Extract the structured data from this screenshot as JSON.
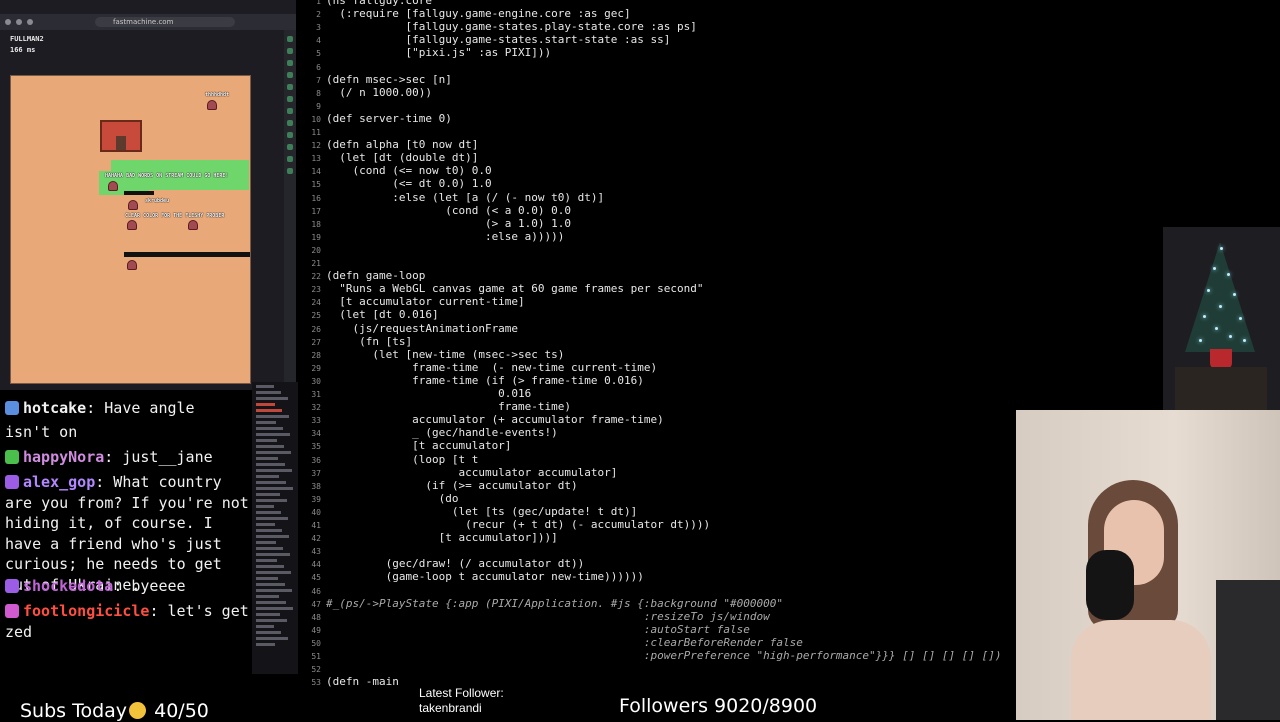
{
  "browser": {
    "url": "fastmachine.com",
    "page_info": [
      "FULLMAN2",
      "166 ms"
    ],
    "game_labels": {
      "npc_top": "thhhdhdt",
      "banner1": "HAHAHA BAD WORDS ON STREAM COULD GO HERE!",
      "banner2": "CLEAR COLOR FOR THE FLESHY PROBER",
      "small": "skrubdeu"
    }
  },
  "editor": {
    "lines": [
      {
        "n": "1",
        "t": "(ns fallguy.core"
      },
      {
        "n": "2",
        "t": "  (:require [fallguy.game-engine.core :as gec]"
      },
      {
        "n": "3",
        "t": "            [fallguy.game-states.play-state.core :as ps]"
      },
      {
        "n": "4",
        "t": "            [fallguy.game-states.start-state :as ss]"
      },
      {
        "n": "5",
        "t": "            [\"pixi.js\" :as PIXI]))"
      },
      {
        "n": "6",
        "t": ""
      },
      {
        "n": "7",
        "t": "(defn msec->sec [n]"
      },
      {
        "n": "8",
        "t": "  (/ n 1000.00))"
      },
      {
        "n": "9",
        "t": ""
      },
      {
        "n": "10",
        "t": "(def server-time 0)"
      },
      {
        "n": "11",
        "t": ""
      },
      {
        "n": "12",
        "t": "(defn alpha [t0 now dt]"
      },
      {
        "n": "13",
        "t": "  (let [dt (double dt)]"
      },
      {
        "n": "14",
        "t": "    (cond (<= now t0) 0.0"
      },
      {
        "n": "15",
        "t": "          (<= dt 0.0) 1.0"
      },
      {
        "n": "16",
        "t": "          :else (let [a (/ (- now t0) dt)]"
      },
      {
        "n": "17",
        "t": "                  (cond (< a 0.0) 0.0"
      },
      {
        "n": "18",
        "t": "                        (> a 1.0) 1.0"
      },
      {
        "n": "19",
        "t": "                        :else a)))))"
      },
      {
        "n": "20",
        "t": ""
      },
      {
        "n": "21",
        "t": ""
      },
      {
        "n": "22",
        "t": "(defn game-loop"
      },
      {
        "n": "23",
        "t": "  \"Runs a WebGL canvas game at 60 game frames per second\""
      },
      {
        "n": "24",
        "t": "  [t accumulator current-time]"
      },
      {
        "n": "25",
        "t": "  (let [dt 0.016]"
      },
      {
        "n": "26",
        "t": "    (js/requestAnimationFrame"
      },
      {
        "n": "27",
        "t": "     (fn [ts]"
      },
      {
        "n": "28",
        "t": "       (let [new-time (msec->sec ts)"
      },
      {
        "n": "29",
        "t": "             frame-time  (- new-time current-time)"
      },
      {
        "n": "30",
        "t": "             frame-time (if (> frame-time 0.016)"
      },
      {
        "n": "31",
        "t": "                          0.016"
      },
      {
        "n": "32",
        "t": "                          frame-time)"
      },
      {
        "n": "33",
        "t": "             accumulator (+ accumulator frame-time)"
      },
      {
        "n": "34",
        "t": "             _ (gec/handle-events!)"
      },
      {
        "n": "35",
        "t": "             [t accumulator]"
      },
      {
        "n": "36",
        "t": "             (loop [t t"
      },
      {
        "n": "37",
        "t": "                    accumulator accumulator]"
      },
      {
        "n": "38",
        "t": "               (if (>= accumulator dt)"
      },
      {
        "n": "39",
        "t": "                 (do"
      },
      {
        "n": "40",
        "t": "                   (let [ts (gec/update! t dt)]"
      },
      {
        "n": "41",
        "t": "                     (recur (+ t dt) (- accumulator dt))))"
      },
      {
        "n": "42",
        "t": "                 [t accumulator]))]"
      },
      {
        "n": "43",
        "t": ""
      },
      {
        "n": "44",
        "t": "         (gec/draw! (/ accumulator dt))"
      },
      {
        "n": "45",
        "t": "         (game-loop t accumulator new-time))))))"
      },
      {
        "n": "46",
        "t": ""
      },
      {
        "n": "47",
        "t": "#_(ps/->PlayState {:app (PIXI/Application. #js {:background \"#000000\"",
        "c": true
      },
      {
        "n": "48",
        "t": "                                                :resizeTo js/window",
        "c": true
      },
      {
        "n": "49",
        "t": "                                                :autoStart false",
        "c": true
      },
      {
        "n": "50",
        "t": "                                                :clearBeforeRender false",
        "c": true
      },
      {
        "n": "51",
        "t": "                                                :powerPreference \"high-performance\"}}} [] [] [] [] [])",
        "c": true
      },
      {
        "n": "52",
        "t": ""
      },
      {
        "n": "53",
        "t": "(defn -main"
      }
    ]
  },
  "chat": {
    "messages": [
      {
        "user": "hotcake",
        "text": ": Have angle"
      },
      {
        "user": "",
        "text": "isn't on"
      },
      {
        "user": "happyNora",
        "text": ": just__jane"
      },
      {
        "user": "alex_gop",
        "text": ": What country are you from? If you're not hiding it, of course. I have a friend who's just curious; he needs to get out of Ukraine."
      },
      {
        "user": "shockedota",
        "text": ": byeeee"
      },
      {
        "user": "footlongicicle",
        "text": ": let's get zed"
      }
    ],
    "user_colors": {
      "hotcake": "#f2f2f2",
      "happyNora": "#d08ce0",
      "alex_gop": "#b287ff",
      "shockedota": "#c064d8",
      "footlongicicle": "#ff4f43"
    }
  },
  "overlay": {
    "subs_label": "Subs Today",
    "subs_value": "40/50",
    "latest_follower_label": "Latest Follower:",
    "latest_follower_name": "takenbrandi",
    "followers_text": "Followers 9020/8900"
  }
}
